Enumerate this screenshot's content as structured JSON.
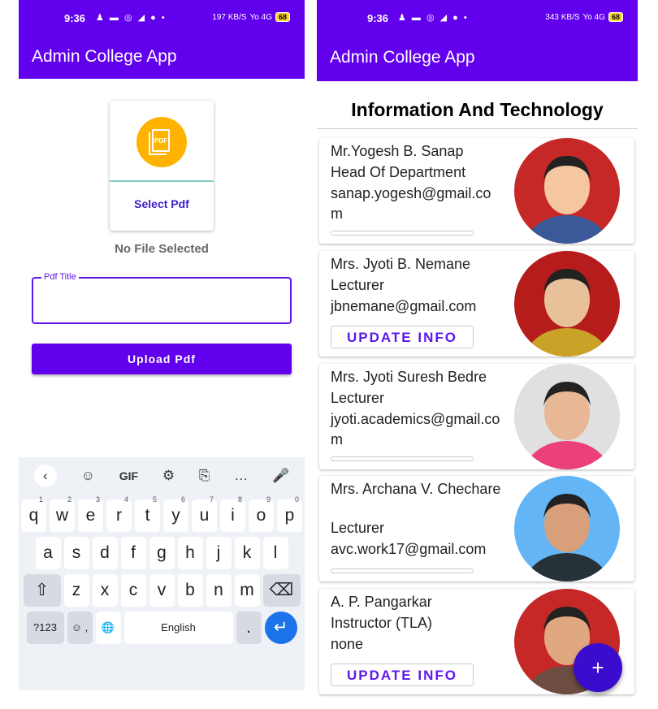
{
  "left": {
    "status": {
      "time": "9:36",
      "icons": "♟ ▬ ◎ ◢ ● •",
      "speed": "197 KB/S",
      "net": "Yo 4G",
      "battery": "68"
    },
    "app_title": "Admin College App",
    "select_pdf": "Select Pdf",
    "pdf_badge": "PDF",
    "no_file": "No File Selected",
    "title_field_label": "Pdf Title",
    "title_field_value": "",
    "upload_button": "Upload Pdf",
    "keyboard": {
      "toolbar": [
        "‹",
        "☺",
        "GIF",
        "⚙",
        "⎘",
        "…",
        "🎤"
      ],
      "row1": [
        [
          "q",
          "1"
        ],
        [
          "w",
          "2"
        ],
        [
          "e",
          "3"
        ],
        [
          "r",
          "4"
        ],
        [
          "t",
          "5"
        ],
        [
          "y",
          "6"
        ],
        [
          "u",
          "7"
        ],
        [
          "i",
          "8"
        ],
        [
          "o",
          "9"
        ],
        [
          "p",
          "0"
        ]
      ],
      "row2": [
        "a",
        "s",
        "d",
        "f",
        "g",
        "h",
        "j",
        "k",
        "l"
      ],
      "row3": [
        "z",
        "x",
        "c",
        "v",
        "b",
        "n",
        "m"
      ],
      "shift": "⇧",
      "backspace": "⌫",
      "numbers": "?123",
      "emoji": "☺ ,",
      "globe": "🌐",
      "space": "English",
      "period": ".",
      "enter": "↵"
    }
  },
  "right": {
    "status": {
      "time": "9:36",
      "icons": "♟ ▬ ◎ ◢ ● •",
      "speed": "343 KB/S",
      "net": "Yo 4G",
      "battery": "68"
    },
    "app_title": "Admin College App",
    "department": "Information And Technology",
    "faculty": [
      {
        "name": "Mr.Yogesh B. Sanap",
        "post": "Head Of Department",
        "email": "sanap.yogesh@gmail.com",
        "button": ""
      },
      {
        "name": "Mrs. Jyoti B. Nemane",
        "post": "Lecturer",
        "email": "jbnemane@gmail.com",
        "button": "UPDATE INFO"
      },
      {
        "name": "Mrs. Jyoti Suresh Bedre",
        "post": "Lecturer",
        "email": "jyoti.academics@gmail.com",
        "button": ""
      },
      {
        "name": "Mrs. Archana V. Chechare",
        "post": "Lecturer",
        "email": "avc.work17@gmail.com",
        "button": ""
      },
      {
        "name": "A. P. Pangarkar",
        "post": "Instructor (TLA)",
        "email": "none",
        "button": "UPDATE INFO"
      }
    ],
    "fab": "+"
  },
  "colors": {
    "primary": "#6200ee",
    "accent": "#5e17eb",
    "pdf_icon": "#ffb300",
    "fab": "#3a0ccd"
  }
}
